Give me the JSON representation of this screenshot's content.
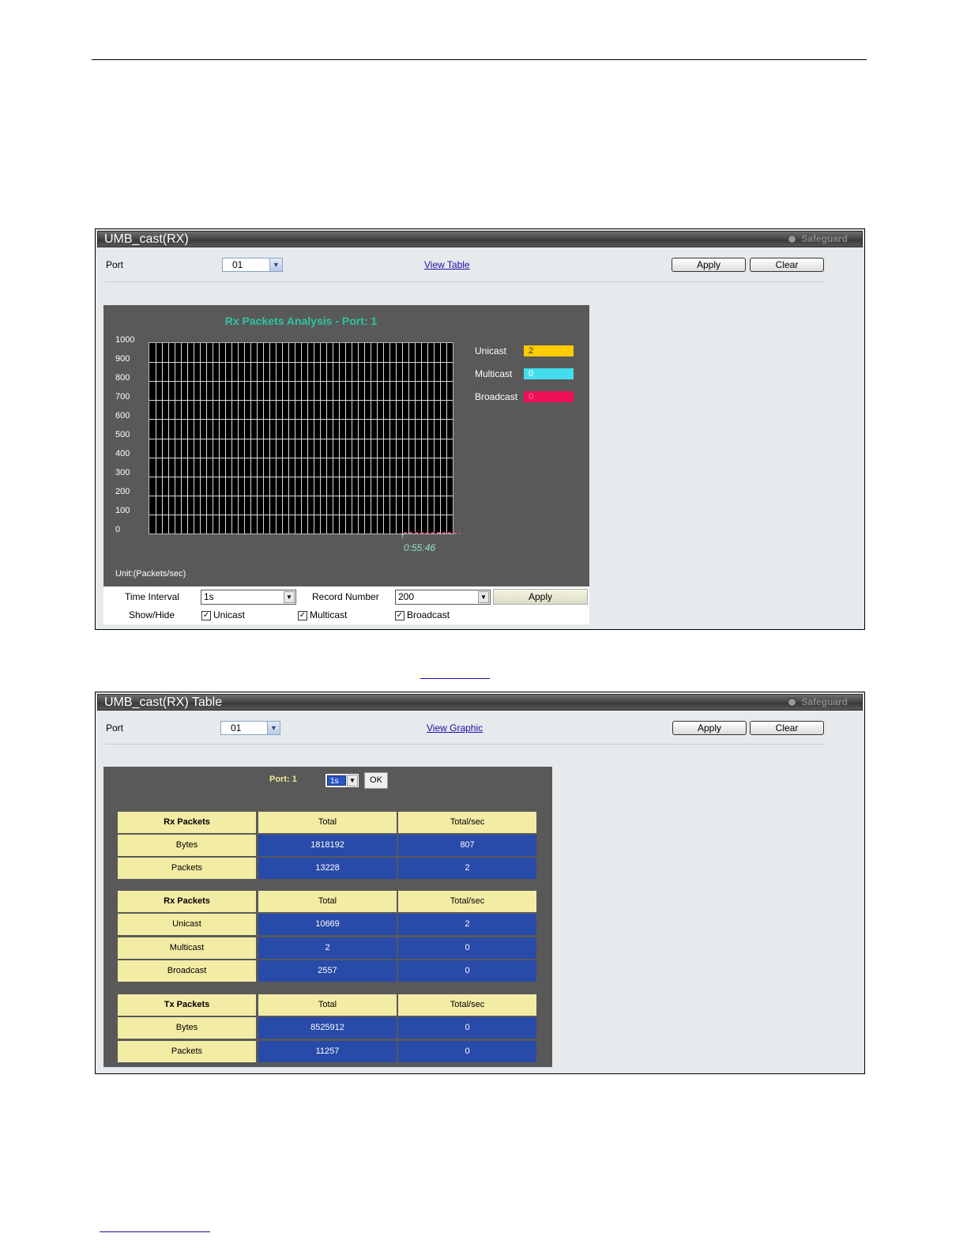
{
  "graphic_panel": {
    "title": "UMB_cast(RX)",
    "safeguard": "Safeguard",
    "port_label": "Port",
    "port_value": "01",
    "view_link": "View Table",
    "apply_label": "Apply",
    "clear_label": "Clear",
    "chart_title": "Rx Packets Analysis - Port: 1",
    "y_ticks": [
      "1000",
      "900",
      "800",
      "700",
      "600",
      "500",
      "400",
      "300",
      "200",
      "100",
      "0"
    ],
    "legend": [
      {
        "name": "Unicast",
        "value": "2",
        "color": "#ffcc00"
      },
      {
        "name": "Multicast",
        "value": "0",
        "color": "#44ddee"
      },
      {
        "name": "Broadcast",
        "value": "0",
        "color": "#ee1155"
      }
    ],
    "time_label": "0:55:46",
    "unit_label": "Unit:(Packets/sec)",
    "controls": {
      "time_interval_label": "Time Interval",
      "time_interval_value": "1s",
      "record_number_label": "Record Number",
      "record_number_value": "200",
      "apply_label": "Apply",
      "show_hide_label": "Show/Hide",
      "unicast_label": "Unicast",
      "multicast_label": "Multicast",
      "broadcast_label": "Broadcast"
    }
  },
  "table_panel": {
    "title": "UMB_cast(RX) Table",
    "safeguard": "Safeguard",
    "port_label": "Port",
    "port_value": "01",
    "view_link": "View Graphic",
    "apply_label": "Apply",
    "clear_label": "Clear",
    "port_heading": "Port: 1",
    "interval_value": "1s",
    "ok_label": "OK",
    "tables": [
      {
        "headers": [
          "Rx Packets",
          "Total",
          "Total/sec"
        ],
        "rows": [
          [
            "Bytes",
            "1818192",
            "807"
          ],
          [
            "Packets",
            "13228",
            "2"
          ]
        ]
      },
      {
        "headers": [
          "Rx Packets",
          "Total",
          "Total/sec"
        ],
        "rows": [
          [
            "Unicast",
            "10669",
            "2"
          ],
          [
            "Multicast",
            "2",
            "0"
          ],
          [
            "Broadcast",
            "2557",
            "0"
          ]
        ]
      },
      {
        "headers": [
          "Tx Packets",
          "Total",
          "Total/sec"
        ],
        "rows": [
          [
            "Bytes",
            "8525912",
            "0"
          ],
          [
            "Packets",
            "11257",
            "0"
          ]
        ]
      }
    ]
  },
  "chart_data": {
    "type": "line",
    "title": "Rx Packets Analysis - Port: 1",
    "ylabel": "Unit:(Packets/sec)",
    "ylim": [
      0,
      1000
    ],
    "x": [
      "0:55:46"
    ],
    "series": [
      {
        "name": "Unicast",
        "values": [
          2
        ]
      },
      {
        "name": "Multicast",
        "values": [
          0
        ]
      },
      {
        "name": "Broadcast",
        "values": [
          0
        ]
      }
    ]
  }
}
